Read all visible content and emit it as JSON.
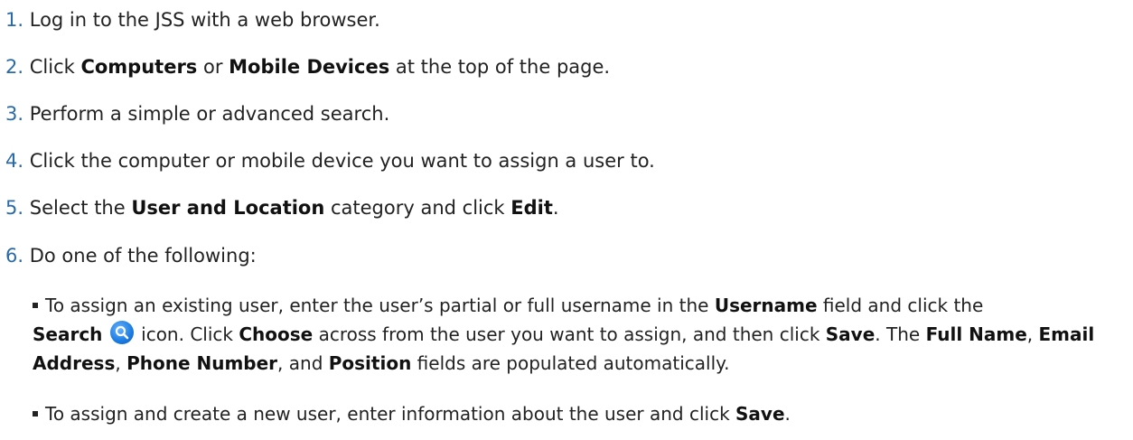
{
  "steps": [
    {
      "num": "1.",
      "text": "Log in to the JSS with a web browser."
    },
    {
      "num": "2.",
      "pre": "Click ",
      "b1": "Computers",
      "mid": " or ",
      "b2": "Mobile Devices",
      "post": " at the top of the page."
    },
    {
      "num": "3.",
      "text": "Perform a simple or advanced search."
    },
    {
      "num": "4.",
      "text": "Click the computer or mobile device you want to assign a user to."
    },
    {
      "num": "5.",
      "pre": "Select the ",
      "b1": "User and Location",
      "mid": " category and click ",
      "b2": "Edit",
      "post": "."
    },
    {
      "num": "6.",
      "text": "Do one of the following:"
    }
  ],
  "substeps": {
    "a": {
      "t1": "To assign an existing user, enter the user’s partial or full username in the ",
      "b1": "Username",
      "t2": " field and click the ",
      "b2": "Search",
      "t3": " icon. Click ",
      "b3": "Choose",
      "t4": " across from the user you want to assign, and then click ",
      "b4": "Save",
      "t5": ". The ",
      "b5": "Full Name",
      "t6": ", ",
      "b6": "Email Address",
      "t7": ", ",
      "b7": "Phone Number",
      "t8": ", and ",
      "b8": "Position",
      "t9": " fields are populated automatically."
    },
    "b": {
      "t1": "To assign and create a new user, enter information about the user and click ",
      "b1": "Save",
      "t2": "."
    }
  },
  "icons": {
    "search": "search-icon",
    "bullet": "square-bullet-icon"
  },
  "colors": {
    "step_number": "#2a6aa8",
    "search_icon": "#1a7be0"
  }
}
